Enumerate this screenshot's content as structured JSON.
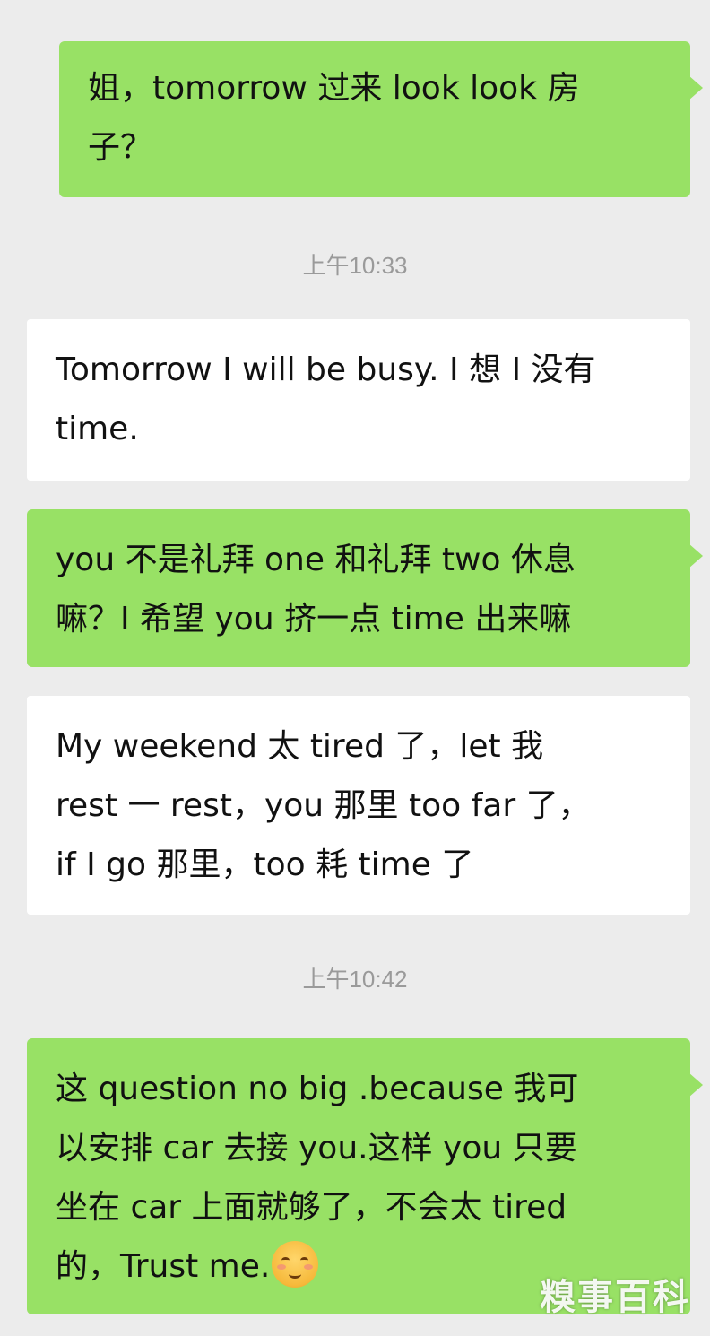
{
  "messages": [
    {
      "side": "out",
      "lines": [
        "姐，tomorrow 过来 look look 房",
        "子？"
      ]
    },
    {
      "type": "timestamp",
      "text": "上午10:33"
    },
    {
      "side": "in",
      "lines": [
        "Tomorrow I will be busy. I 想 I 没有",
        "time."
      ]
    },
    {
      "side": "out",
      "lines": [
        "you 不是礼拜 one 和礼拜 two 休息",
        "嘛？I 希望 you 挤一点 time 出来嘛"
      ]
    },
    {
      "side": "in",
      "lines": [
        "My weekend 太 tired 了，let 我",
        "rest 一 rest，you 那里 too far 了，",
        "if I go 那里，too 耗 time 了"
      ]
    },
    {
      "type": "timestamp",
      "text": "上午10:42"
    },
    {
      "side": "out",
      "lines": [
        "这 question no big .because 我可",
        "以安排 car 去接 you.这样 you 只要",
        "坐在 car 上面就够了，不会太 tired",
        "的，Trust me."
      ],
      "trailing_icon": "blushing-smile-emoji"
    }
  ],
  "watermark": "糗事百科",
  "colors": {
    "background": "#ececec",
    "outgoing_bubble": "#98e165",
    "incoming_bubble": "#ffffff",
    "timestamp_text": "#9a9a9a"
  }
}
